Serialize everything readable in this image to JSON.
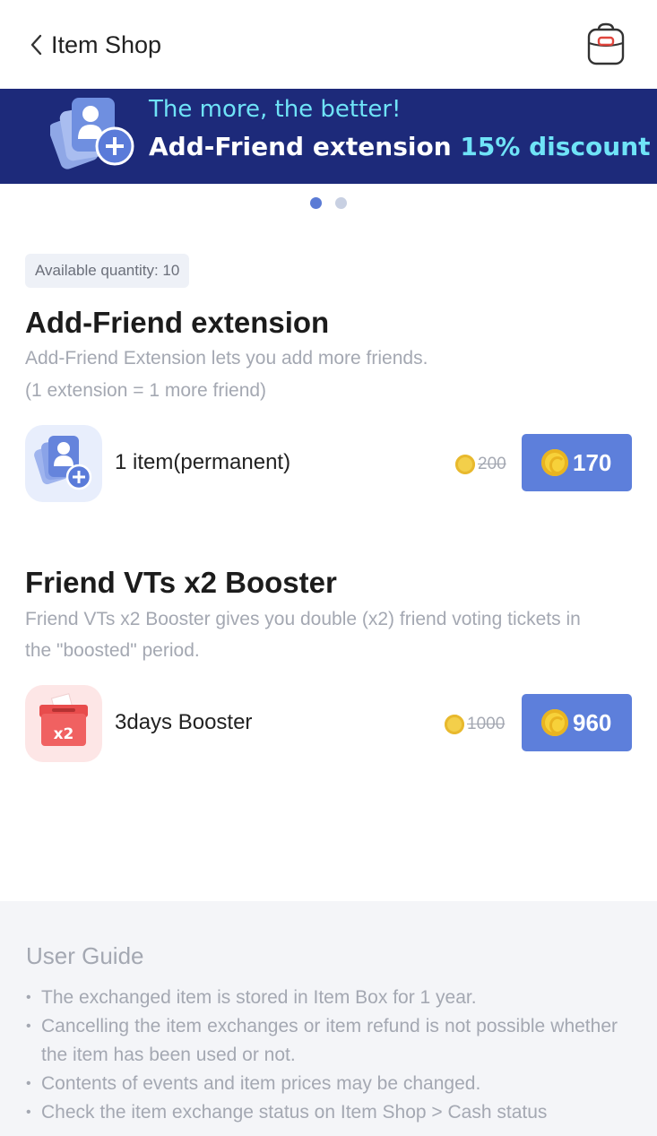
{
  "header": {
    "title": "Item Shop"
  },
  "banner": {
    "line1": "The more, the better!",
    "line2_text": "Add-Friend extension ",
    "line2_highlight": "15% discount",
    "background_color": "#1d2a7a",
    "highlight_color": "#6fe3f7"
  },
  "carousel": {
    "pages": 2,
    "active": 1
  },
  "sections": [
    {
      "badge": "Available quantity: 10",
      "title": "Add-Friend extension",
      "desc_line1": "Add-Friend Extension lets you add more friends.",
      "desc_line2": "(1 extension = 1 more friend)",
      "item": {
        "icon": "add-friend-icon",
        "name": "1 item(permanent)",
        "old_price": "200",
        "price": "170"
      }
    },
    {
      "title": "Friend VTs x2 Booster",
      "desc_line1": "Friend VTs x2 Booster gives you double (x2) friend voting tickets in",
      "desc_line2": "the \"boosted\" period.",
      "item": {
        "icon": "ballot-box-x2-icon",
        "icon_label": "x2",
        "name": "3days Booster",
        "old_price": "1000",
        "price": "960"
      }
    }
  ],
  "guide": {
    "title": "User Guide",
    "items": [
      "The exchanged item is stored in Item Box for 1 year.",
      "Cancelling the item exchanges or item refund is not possible whether the item has been used or not.",
      "Contents of events and item prices may be changed.",
      "Check the item exchange status on Item Shop > Cash status"
    ]
  },
  "colors": {
    "button": "#5d7fdb",
    "muted_text": "#a4a8b2",
    "coin": "#f7d13a"
  }
}
